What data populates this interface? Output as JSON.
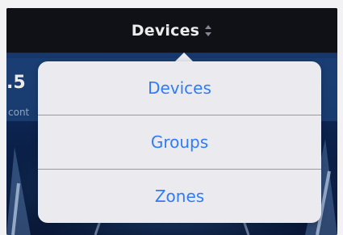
{
  "navbar": {
    "title": "Devices",
    "sort_icon": "sort-updown-icon"
  },
  "background": {
    "value": ".5",
    "subtext": "cont"
  },
  "popover": {
    "items": [
      {
        "label": "Devices"
      },
      {
        "label": "Groups"
      },
      {
        "label": "Zones"
      }
    ]
  },
  "colors": {
    "accent": "#2f7cf6",
    "navbar_bg": "#111319",
    "popover_bg": "#ebebef"
  }
}
